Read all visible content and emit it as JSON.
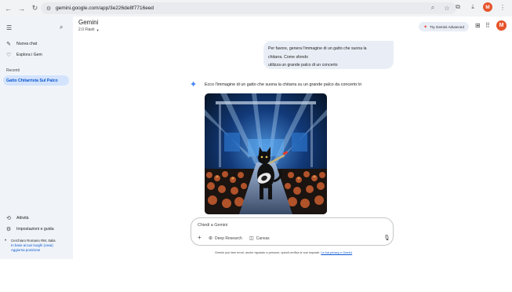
{
  "browser": {
    "url": "gemini.google.com/app/3e226de8f7716eed",
    "profile_initial": "M"
  },
  "sidebar": {
    "new_chat": "Nuova chat",
    "explore_gems": "Esplora i Gem",
    "recent_label": "Recenti",
    "recent_items": [
      "Gatto Chitarrista Sul Palco"
    ],
    "activity": "Attività",
    "settings": "Impostazioni e guida",
    "location": {
      "place": "Cerchiaro Romano RM, Italia",
      "link1": "In base ai tuoi luoghi (casa)",
      "link2": "Aggiorna posizione"
    }
  },
  "header": {
    "title": "Gemini",
    "model": "2.0 Flash",
    "try_advanced": "Try Gemini Advanced",
    "avatar_initial": "M"
  },
  "chat": {
    "user_lines": [
      "Per favore, genera l'immagine di un gatto che suona la",
      "chitarra. Come sfondo",
      "utilizza un grande palco di un concerto"
    ],
    "reply": "Ecco l'immagine di un gatto che suona la chitarra su un grande palco da concerto:\\n"
  },
  "input": {
    "placeholder": "Chiedi a Gemini",
    "deep_research": "Deep Research",
    "canvas": "Canvas"
  },
  "footer": {
    "disclaimer": "Gemini può fare errori, anche riguardo a persone, quindi verifica le sue risposte.",
    "privacy_link": "La tua privacy e Gemini"
  },
  "colors": {
    "sidebar_bg": "#f0f4f9",
    "selected_bg": "#d3e3fd",
    "accent": "#0b57d0",
    "avatar": "#e6542b"
  }
}
